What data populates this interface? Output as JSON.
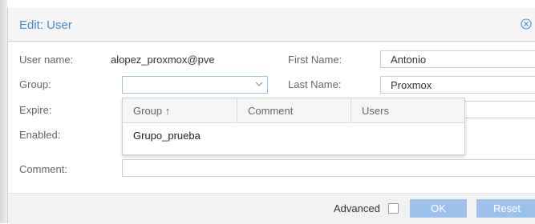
{
  "dialog": {
    "title": "Edit: User",
    "username_label": "User name:",
    "username_value": "alopez_proxmox@pve",
    "group_label": "Group:",
    "group_value": "",
    "expire_label": "Expire:",
    "enabled_label": "Enabled:",
    "comment_label": "Comment:",
    "comment_value": "",
    "firstname_label": "First Name:",
    "firstname_value": "Antonio",
    "lastname_label": "Last Name:",
    "lastname_value": "Proxmox"
  },
  "group_dropdown": {
    "columns": [
      "Group ↑",
      "Comment",
      "Users"
    ],
    "rows": [
      {
        "group": "Grupo_prueba",
        "comment": "",
        "users": ""
      }
    ]
  },
  "footer": {
    "advanced_label": "Advanced",
    "advanced_checked": false,
    "ok_label": "OK",
    "reset_label": "Reset"
  },
  "colors": {
    "title": "#4a8ac9",
    "button": "#9cc2ec",
    "header_bg": "#f5f5f5",
    "footer_bg": "#f1f1f1"
  },
  "icons": {
    "close": "close-circle-icon",
    "dropdown": "chevron-down-icon",
    "sort": "arrow-up-icon"
  }
}
